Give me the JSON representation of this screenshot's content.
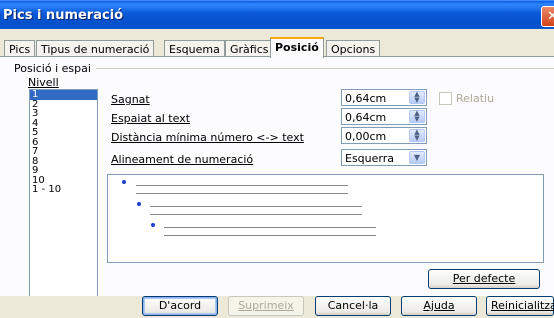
{
  "window": {
    "title": "Pics i numeració"
  },
  "tabs": [
    {
      "label": "Pics",
      "active": false
    },
    {
      "label": "Tipus de numeració",
      "active": false
    },
    {
      "label": "Esquema",
      "active": false
    },
    {
      "label": "Gràfics",
      "active": false
    },
    {
      "label": "Posició",
      "active": true
    },
    {
      "label": "Opcions",
      "active": false
    }
  ],
  "section": {
    "title": "Posició i espai"
  },
  "level": {
    "label": "Nivell",
    "items": [
      "1",
      "2",
      "3",
      "4",
      "5",
      "6",
      "7",
      "8",
      "9",
      "10",
      "1 - 10"
    ],
    "selected": "1"
  },
  "fields": {
    "indent": {
      "label": "Sagnat",
      "value": "0,64cm"
    },
    "spacing": {
      "label": "Espaiat al text",
      "value": "0,64cm"
    },
    "min_distance": {
      "label": "Distància mínima número <-> text",
      "value": "0,00cm"
    },
    "alignment": {
      "label": "Alineament de numeració",
      "value": "Esquerra"
    }
  },
  "relative": {
    "label": "Relatiu",
    "checked": false,
    "enabled": false
  },
  "default_button": {
    "label": "Per defecte"
  },
  "buttons": {
    "ok": "D'acord",
    "delete": "Suprimeix",
    "cancel": "Cancel·la",
    "help": "Ajuda",
    "reset": "Reinicialitza"
  },
  "colors": {
    "accent": "#0a5fe0",
    "selection": "#316ac5",
    "bullet": "#1f3fcf"
  }
}
